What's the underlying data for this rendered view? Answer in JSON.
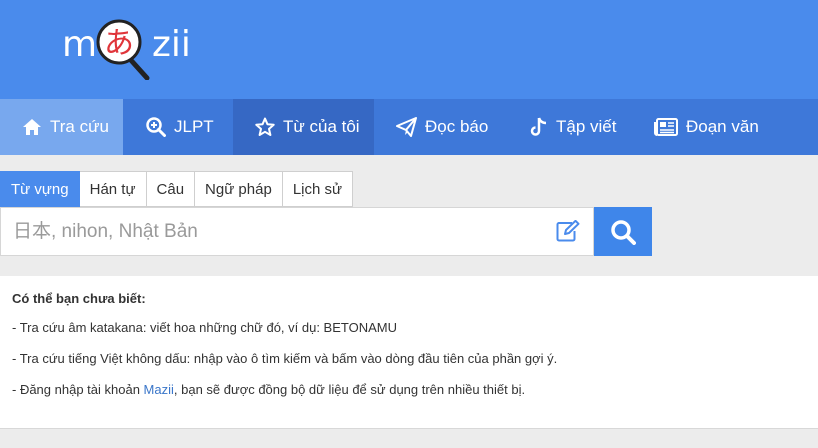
{
  "logo": {
    "left": "m",
    "glyph": "あ",
    "right": "zii"
  },
  "nav": {
    "items": [
      {
        "label": "Tra cứu",
        "icon": "home-icon"
      },
      {
        "label": "JLPT",
        "icon": "zoom-in-icon"
      },
      {
        "label": "Từ của tôi",
        "icon": "star-icon"
      },
      {
        "label": "Đọc báo",
        "icon": "paper-plane-icon"
      },
      {
        "label": "Tập viết",
        "icon": "tiktok-icon"
      },
      {
        "label": "Đoạn văn",
        "icon": "newspaper-icon"
      }
    ]
  },
  "tabs": [
    "Từ vựng",
    "Hán tự",
    "Câu",
    "Ngữ pháp",
    "Lịch sử"
  ],
  "search": {
    "placeholder": "日本, nihon, Nhật Bản",
    "value": ""
  },
  "tips": {
    "title": "Có thể bạn chưa biết:",
    "line1": "- Tra cứu âm katakana: viết hoa những chữ đó, ví dụ: BETONAMU",
    "line2": "- Tra cứu tiếng Việt không dấu: nhập vào ô tìm kiếm và bấm vào dòng đầu tiên của phần gợi ý.",
    "line3_before": "- Đăng nhập tài khoản ",
    "line3_link": "Mazii",
    "line3_after": ", bạn sẽ được đồng bộ dữ liệu để sử dụng trên nhiều thiết bị."
  },
  "colors": {
    "brand": "#4a8bec",
    "nav": "#3e78d9",
    "active_nav": "#78a8ee",
    "search_button": "#3f86ea"
  }
}
